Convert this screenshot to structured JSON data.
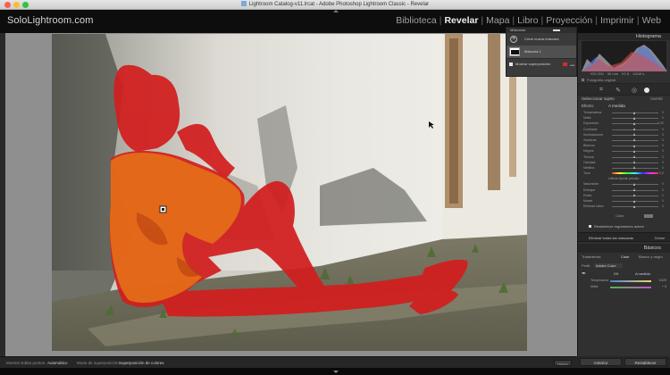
{
  "window": {
    "title": "Lightroom Catalog-v11.lrcat - Adobe Photoshop Lightroom Classic - Revelar"
  },
  "brand": "SoloLightroom.com",
  "modules": [
    {
      "label": "Biblioteca",
      "active": false
    },
    {
      "label": "Revelar",
      "active": true
    },
    {
      "label": "Mapa",
      "active": false
    },
    {
      "label": "Libro",
      "active": false
    },
    {
      "label": "Proyección",
      "active": false
    },
    {
      "label": "Imprimir",
      "active": false
    },
    {
      "label": "Web",
      "active": false
    }
  ],
  "mask_panel": {
    "title": "Máscaras",
    "create_label": "Crear nueva máscara",
    "mask_name": "Máscara 1",
    "overlay_label": "Mostrar superposición",
    "overlay_color": "#d32e2e"
  },
  "histogram": {
    "title": "Histograma",
    "values": [
      "ISO 200",
      "50 mm",
      "f/2,8",
      "1/640 s"
    ],
    "original_label": "Fotografía original"
  },
  "adjustments": {
    "header_left": "Seleccionar sujeto",
    "header_right": "Invertir",
    "effect_label": "Efecto:",
    "effect_value": "A medida",
    "rows": [
      {
        "label": "Temperatura",
        "value": "0"
      },
      {
        "label": "Matiz",
        "value": "0"
      },
      {
        "label": "Exposición",
        "value": "0,00"
      },
      {
        "label": "Contraste",
        "value": "0"
      },
      {
        "label": "Iluminaciones",
        "value": "0"
      },
      {
        "label": "Sombras",
        "value": "0"
      },
      {
        "label": "Blancos",
        "value": "0"
      },
      {
        "label": "Negros",
        "value": "0"
      },
      {
        "label": "Textura",
        "value": "0"
      },
      {
        "label": "Claridad",
        "value": "0"
      },
      {
        "label": "Neblina",
        "value": "0"
      }
    ],
    "hue_label": "Tono",
    "hue_value": "0,0",
    "fine_label": "Utilizar Ajuste preciso",
    "rows2": [
      {
        "label": "Saturación",
        "value": "0"
      },
      {
        "label": "Enfoque",
        "value": "0"
      },
      {
        "label": "Ruido",
        "value": "0"
      },
      {
        "label": "Muaré",
        "value": "0"
      },
      {
        "label": "Eliminar halos",
        "value": "0"
      }
    ],
    "color_label": "Color",
    "reset_label": "Restablecer reguladores autom",
    "delete_label": "Eliminar todas las máscaras",
    "close_label": "Cerrar"
  },
  "basicos": {
    "title": "Básicos",
    "treatment_label": "Tratamiento:",
    "treatment_color": "Color",
    "treatment_bw": "Blanco y negro",
    "profile_label": "Perfil:",
    "profile_value": "Adobe Color",
    "wb_label": "BB:",
    "wb_value": "A medida",
    "temp_label": "Temperatura",
    "temp_value": "6325",
    "tint_label": "Matiz",
    "tint_value": "+ 8"
  },
  "buttons": {
    "previous": "Anterior",
    "reset": "Restablecer"
  },
  "toolbar": {
    "pins_label": "Mostrar Editar puntos:",
    "pins_value": "Automático",
    "overlay_mode_label": "Modo de superposición:",
    "overlay_mode_value": "Superposición de colores",
    "done": "Hecho"
  },
  "colors": {
    "mask_overlay": "#d21e1e",
    "accent": "#e6e6e6"
  }
}
